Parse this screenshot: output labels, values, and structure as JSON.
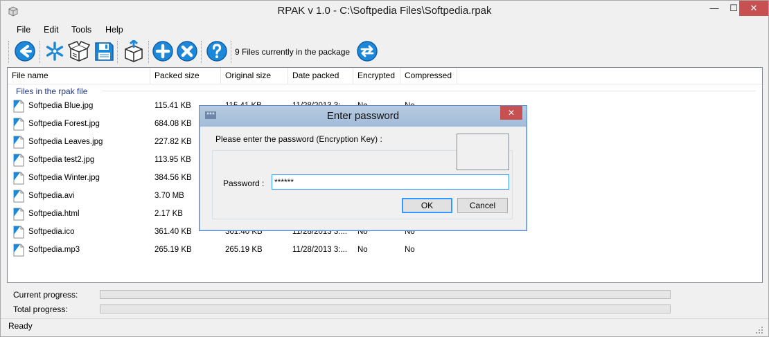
{
  "window": {
    "title": "RPAK v 1.0 - C:\\Softpedia Files\\Softpedia.rpak",
    "min_glyph": "—",
    "max_glyph": "☐",
    "close_glyph": "✕"
  },
  "menu": [
    "File",
    "Edit",
    "Tools",
    "Help"
  ],
  "toolbar": {
    "buttons": [
      {
        "icon": "back-arrow-icon"
      },
      {
        "icon": "asterisk-new-icon"
      },
      {
        "icon": "open-package-icon"
      },
      {
        "icon": "save-floppy-icon"
      },
      {
        "icon": "extract-package-icon"
      },
      {
        "icon": "add-plus-icon"
      },
      {
        "icon": "remove-x-icon"
      },
      {
        "icon": "help-question-icon"
      },
      {
        "icon": "refresh-sync-icon"
      }
    ],
    "status": "9 Files currently in the package"
  },
  "list": {
    "columns": [
      "File name",
      "Packed size",
      "Original size",
      "Date packed",
      "Encrypted",
      "Compressed"
    ],
    "group": "Files in the rpak file",
    "rows": [
      {
        "name": "Softpedia Blue.jpg",
        "packed": "115.41 KB",
        "original": "115.41 KB",
        "date": "11/28/2013 3:...",
        "encrypted": "No",
        "compressed": "No"
      },
      {
        "name": "Softpedia Forest.jpg",
        "packed": "684.08 KB",
        "original": "",
        "date": "",
        "encrypted": "",
        "compressed": ""
      },
      {
        "name": "Softpedia Leaves.jpg",
        "packed": "227.82 KB",
        "original": "",
        "date": "",
        "encrypted": "",
        "compressed": ""
      },
      {
        "name": "Softpedia test2.jpg",
        "packed": "113.95 KB",
        "original": "",
        "date": "",
        "encrypted": "",
        "compressed": ""
      },
      {
        "name": "Softpedia Winter.jpg",
        "packed": "384.56 KB",
        "original": "",
        "date": "",
        "encrypted": "",
        "compressed": ""
      },
      {
        "name": "Softpedia.avi",
        "packed": "3.70 MB",
        "original": "",
        "date": "",
        "encrypted": "",
        "compressed": ""
      },
      {
        "name": "Softpedia.html",
        "packed": "2.17 KB",
        "original": "",
        "date": "",
        "encrypted": "",
        "compressed": ""
      },
      {
        "name": "Softpedia.ico",
        "packed": "361.40 KB",
        "original": "361.40 KB",
        "date": "11/28/2013 3:...",
        "encrypted": "No",
        "compressed": "No"
      },
      {
        "name": "Softpedia.mp3",
        "packed": "265.19 KB",
        "original": "265.19 KB",
        "date": "11/28/2013 3:...",
        "encrypted": "No",
        "compressed": "No"
      }
    ]
  },
  "progress": {
    "current_label": "Current progress:",
    "current_value": 0,
    "total_label": "Total progress:",
    "total_value": 0
  },
  "status": "Ready",
  "dialog": {
    "icon_text": "***",
    "title": "Enter password",
    "close_glyph": "✕",
    "prompt": "Please enter the password (Encryption Key) :",
    "password_label": "Password :",
    "password_value": "******",
    "ok": "OK",
    "cancel": "Cancel"
  },
  "colors": {
    "accent_blue": "#1e88d8",
    "close_red": "#c75050",
    "group_text": "#1e3287"
  }
}
